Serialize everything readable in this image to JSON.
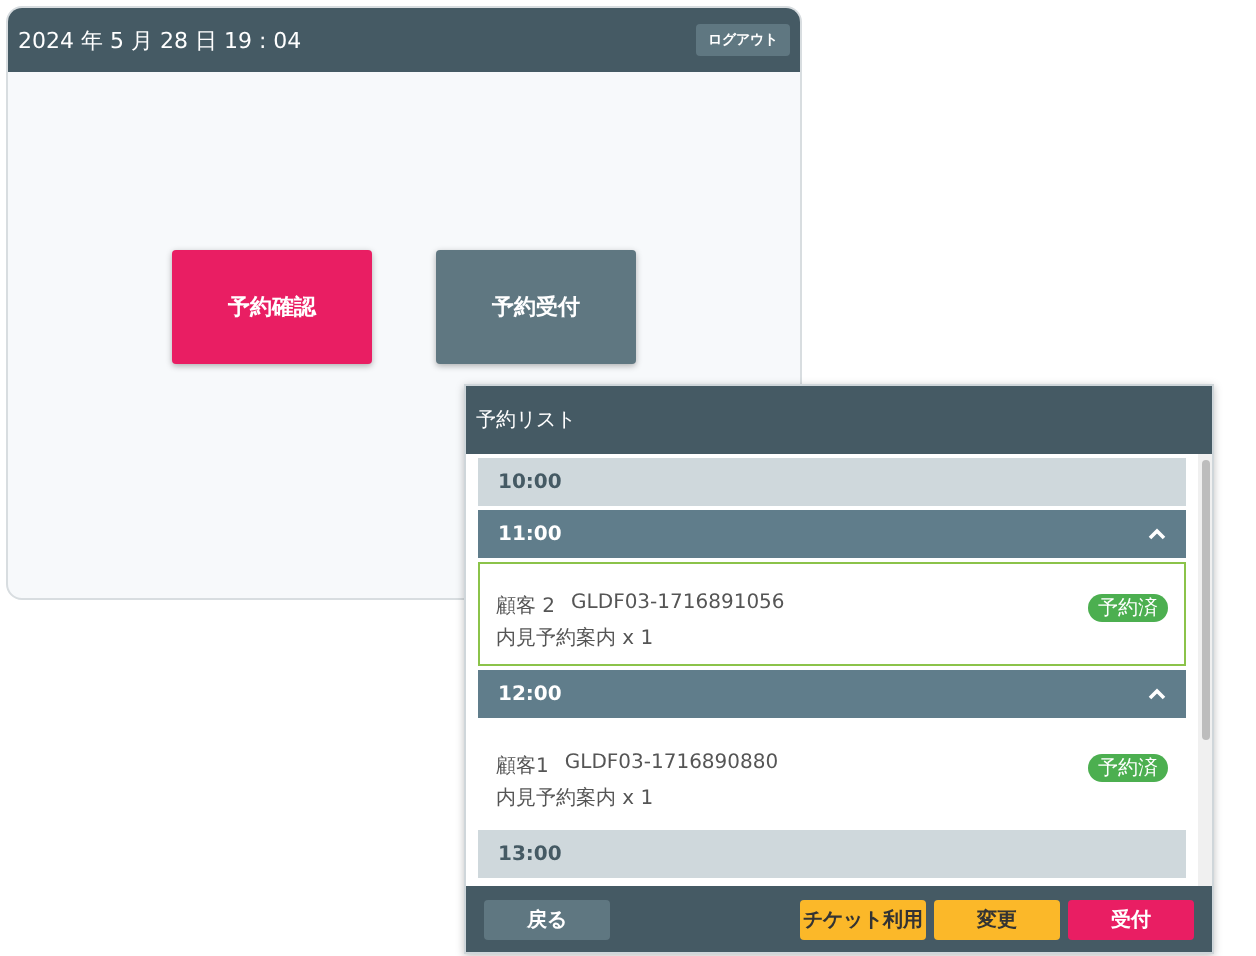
{
  "main_window": {
    "datetime": "2024 年 5 月 28 日  19 : 04",
    "logout_button": "ログアウト",
    "actions": [
      {
        "label": "予約確認",
        "kind": "primary"
      },
      {
        "label": "予約受付",
        "kind": "secondary"
      }
    ]
  },
  "reservation_panel": {
    "title": "予約リスト",
    "slots": [
      {
        "time": "10:00",
        "expanded": false
      },
      {
        "time": "11:00",
        "expanded": true,
        "reservations": [
          {
            "customer": "顧客 2",
            "code": "GLDF03-1716891056",
            "detail": "内見予約案内 x 1",
            "badge": "予約済",
            "selected": true
          }
        ]
      },
      {
        "time": "12:00",
        "expanded": true,
        "reservations": [
          {
            "customer": "顧客1",
            "code": "GLDF03-1716890880",
            "detail": "内見予約案内 x 1",
            "badge": "予約済",
            "selected": false
          }
        ]
      },
      {
        "time": "13:00",
        "expanded": false
      }
    ],
    "footer_buttons": [
      {
        "label": "戻る",
        "kind": "back"
      },
      {
        "label": "チケット利用",
        "kind": "warning"
      },
      {
        "label": "変更",
        "kind": "warning"
      },
      {
        "label": "受付",
        "kind": "primary"
      }
    ]
  }
}
